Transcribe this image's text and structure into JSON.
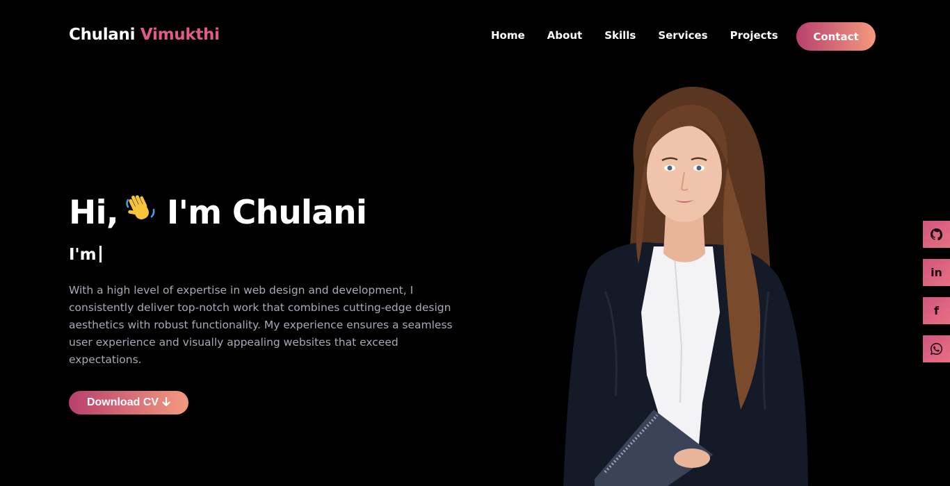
{
  "brand": {
    "first": "Chulani",
    "last": "Vimukthi"
  },
  "nav": {
    "items": [
      "Home",
      "About",
      "Skills",
      "Services",
      "Projects"
    ],
    "contact": "Contact"
  },
  "hero": {
    "greeting": "Hi,",
    "wave_icon": "👋",
    "name_line": "I'm Chulani",
    "typing_prefix": "I'm",
    "intro": "With a high level of expertise in web design and development, I consistently deliver top-notch work that combines cutting-edge design aesthetics with robust functionality. My experience ensures a seamless user experience and visually appealing websites that exceed expectations.",
    "cv_button": "Download CV",
    "cv_icon": "arrow-down-icon"
  },
  "social": [
    {
      "icon": "github-icon",
      "glyph": ""
    },
    {
      "icon": "linkedin-icon",
      "glyph": "in"
    },
    {
      "icon": "facebook-icon",
      "glyph": "f"
    },
    {
      "icon": "whatsapp-icon",
      "glyph": ""
    }
  ],
  "colors": {
    "background": "#000000",
    "accent": "#e05c86",
    "gradient_start": "#b8406e",
    "gradient_end": "#f49a7e",
    "body_text": "#a9a9b8"
  }
}
